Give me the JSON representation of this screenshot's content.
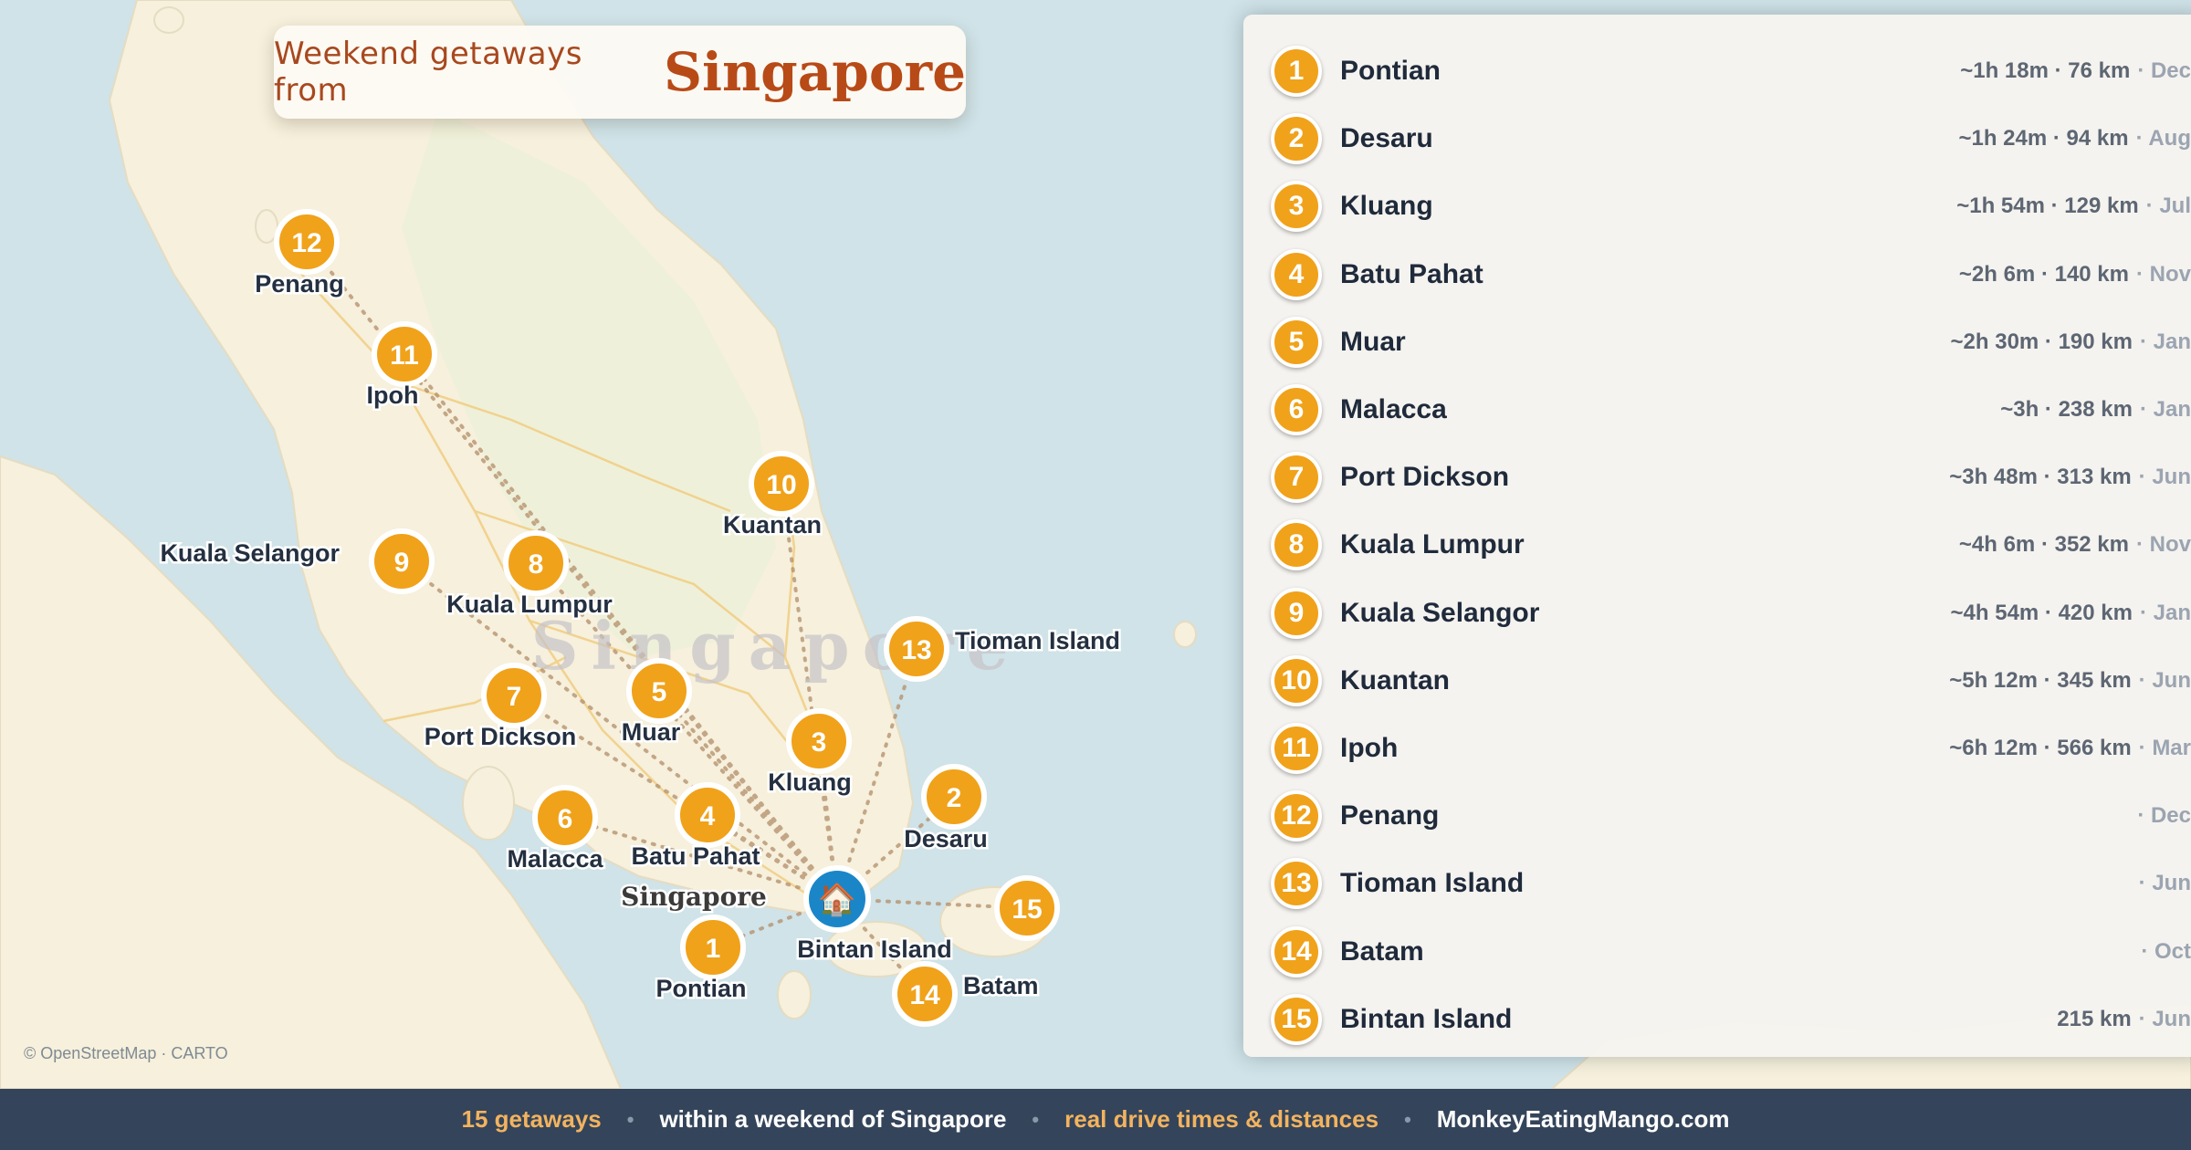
{
  "title": {
    "prefix": "Weekend getaways from",
    "main": "Singapore"
  },
  "map": {
    "watermark": "Singapore",
    "home_marker": {
      "label": "Bintan Island",
      "icon": "house-icon"
    },
    "region_label": "Singapore",
    "attribution": "© OpenStreetMap · CARTO",
    "markers": [
      {
        "num": "1",
        "label": "Pontian"
      },
      {
        "num": "2",
        "label": "Desaru"
      },
      {
        "num": "3",
        "label": "Kluang"
      },
      {
        "num": "4",
        "label": "Batu Pahat"
      },
      {
        "num": "5",
        "label": "Muar"
      },
      {
        "num": "6",
        "label": "Malacca"
      },
      {
        "num": "7",
        "label": "Port Dickson"
      },
      {
        "num": "8",
        "label": "Kuala Lumpur"
      },
      {
        "num": "9",
        "label": "Kuala Selangor"
      },
      {
        "num": "10",
        "label": "Kuantan"
      },
      {
        "num": "11",
        "label": "Ipoh"
      },
      {
        "num": "12",
        "label": "Penang"
      },
      {
        "num": "13",
        "label": "Tioman Island"
      },
      {
        "num": "14",
        "label": "Batam"
      },
      {
        "num": "15",
        "label": ""
      }
    ]
  },
  "list": [
    {
      "num": "1",
      "name": "Pontian",
      "meta": "~1h 18m · 76 km",
      "month": "· Dec"
    },
    {
      "num": "2",
      "name": "Desaru",
      "meta": "~1h 24m · 94 km",
      "month": "· Aug"
    },
    {
      "num": "3",
      "name": "Kluang",
      "meta": "~1h 54m · 129 km",
      "month": "· Jul"
    },
    {
      "num": "4",
      "name": "Batu Pahat",
      "meta": "~2h 6m · 140 km",
      "month": "· Nov"
    },
    {
      "num": "5",
      "name": "Muar",
      "meta": "~2h 30m · 190 km",
      "month": "· Jan"
    },
    {
      "num": "6",
      "name": "Malacca",
      "meta": "~3h · 238 km",
      "month": "· Jan"
    },
    {
      "num": "7",
      "name": "Port Dickson",
      "meta": "~3h 48m · 313 km",
      "month": "· Jun"
    },
    {
      "num": "8",
      "name": "Kuala Lumpur",
      "meta": "~4h 6m · 352 km",
      "month": "· Nov"
    },
    {
      "num": "9",
      "name": "Kuala Selangor",
      "meta": "~4h 54m · 420 km",
      "month": "· Jan"
    },
    {
      "num": "10",
      "name": "Kuantan",
      "meta": "~5h 12m · 345 km",
      "month": "· Jun"
    },
    {
      "num": "11",
      "name": "Ipoh",
      "meta": "~6h 12m · 566 km",
      "month": "· Mar"
    },
    {
      "num": "12",
      "name": "Penang",
      "meta": "",
      "month": "· Dec"
    },
    {
      "num": "13",
      "name": "Tioman Island",
      "meta": "",
      "month": "· Jun"
    },
    {
      "num": "14",
      "name": "Batam",
      "meta": "",
      "month": "· Oct"
    },
    {
      "num": "15",
      "name": "Bintan Island",
      "meta": "215 km",
      "month": "· Jun"
    }
  ],
  "footer": {
    "item1": "15 getaways",
    "item2": "within a weekend of Singapore",
    "item3": "real drive times & distances",
    "item4": "MonkeyEatingMango.com",
    "separator": "•"
  },
  "colors": {
    "marker": "#f0a21a",
    "home_marker": "#1a86c8",
    "land": "#f7f1df",
    "water": "#cfe3e8",
    "footer_bg": "#34445a",
    "accent_title": "#b84a17"
  }
}
